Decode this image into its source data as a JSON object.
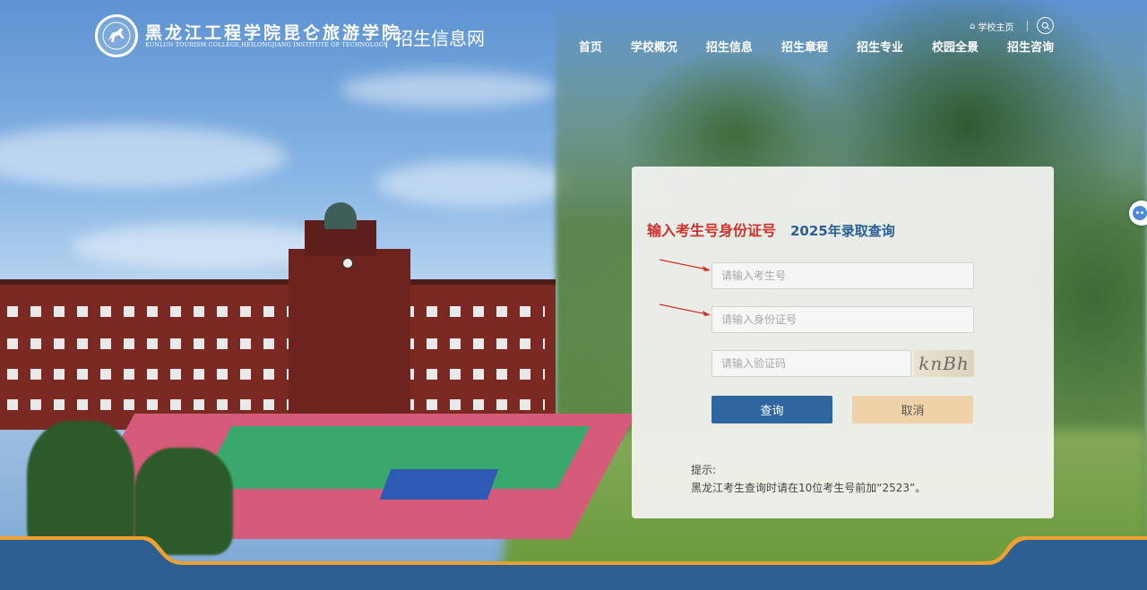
{
  "header": {
    "school_name_cn": "黑龙江工程学院昆仑旅游学院",
    "school_name_en": "KUNLUN TOURISM COLLEGE,HEILONGJIANG INSTITUTE OF TECHNOLOGY",
    "site_name": "招生信息网",
    "home_link_label": "学校主页"
  },
  "nav": {
    "items": [
      "首页",
      "学校概况",
      "招生信息",
      "招生章程",
      "招生专业",
      "校园全景",
      "招生咨询"
    ]
  },
  "panel": {
    "hint_title": "输入考生号身份证号",
    "query_title": "2025年录取查询",
    "exam_no_placeholder": "请输入考生号",
    "id_no_placeholder": "请输入身份证号",
    "captcha_placeholder": "请输入验证码",
    "captcha_text": "knBh",
    "query_button": "查询",
    "cancel_button": "取消",
    "tip_label": "提示:",
    "tip_text": "黑龙江考生查询时请在10位考生号前加“2523”。"
  },
  "colors": {
    "accent_blue": "#2f66a0",
    "accent_red": "#d0302b",
    "cancel_beige": "#efd2a8",
    "band_orange": "#f0a030",
    "band_blue": "#2e5f93"
  },
  "icons": [
    "logo-horse-icon",
    "home-icon",
    "search-icon",
    "chat-bot-icon",
    "arrow-icon"
  ]
}
